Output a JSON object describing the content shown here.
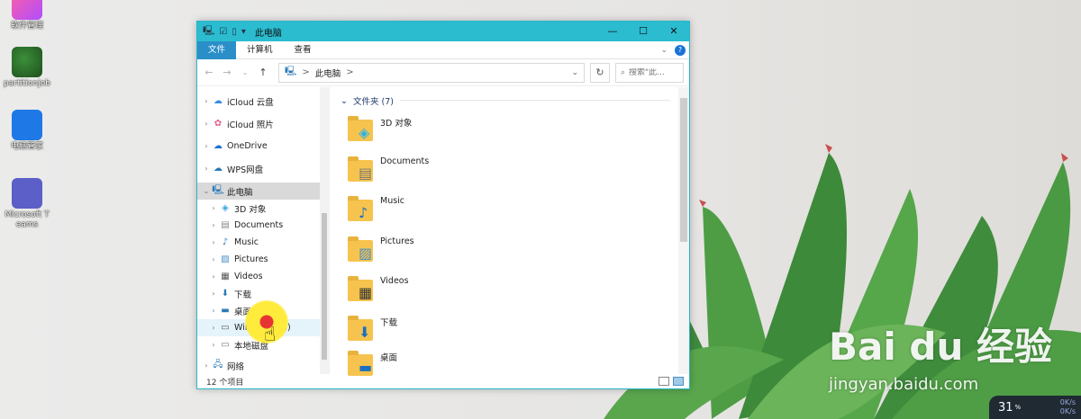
{
  "desktop": {
    "icons": [
      {
        "label": "软件管理",
        "icon": "software-manager-icon"
      },
      {
        "label": "partitionjob",
        "icon": "partition-icon"
      },
      {
        "label": "电脑管家",
        "icon": "pc-manager-icon"
      },
      {
        "label": "Microsoft Teams",
        "icon": "teams-icon"
      }
    ]
  },
  "window": {
    "title": "此电脑",
    "ribbon_tabs": [
      "文件",
      "计算机",
      "查看"
    ],
    "address": {
      "crumb": "此电脑",
      "separator": ">"
    },
    "search_placeholder": "搜索\"此...",
    "nav_tree": [
      {
        "label": "iCloud 云盘",
        "icon": "icloud-icon"
      },
      {
        "label": "iCloud 照片",
        "icon": "photos-icon"
      },
      {
        "label": "OneDrive",
        "icon": "onedrive-icon"
      },
      {
        "label": "WPS网盘",
        "icon": "cloud-icon"
      },
      {
        "label": "此电脑",
        "icon": "computer-icon"
      },
      {
        "label": "3D 对象",
        "icon": "3d-objects-icon"
      },
      {
        "label": "Documents",
        "icon": "documents-icon"
      },
      {
        "label": "Music",
        "icon": "music-icon"
      },
      {
        "label": "Pictures",
        "icon": "pictures-icon"
      },
      {
        "label": "Videos",
        "icon": "videos-icon"
      },
      {
        "label": "下载",
        "icon": "download-icon"
      },
      {
        "label": "桌面",
        "icon": "desktop-icon"
      },
      {
        "label": "Windows (C:)",
        "icon": "drive-icon"
      },
      {
        "label": "本地磁盘",
        "icon": "disk-icon"
      },
      {
        "label": "网络",
        "icon": "network-icon"
      }
    ],
    "group_header": "文件夹 (7)",
    "folders": [
      {
        "name": "3D 对象",
        "icon": "3d-objects-icon"
      },
      {
        "name": "Documents",
        "icon": "documents-icon"
      },
      {
        "name": "Music",
        "icon": "music-icon"
      },
      {
        "name": "Pictures",
        "icon": "pictures-icon"
      },
      {
        "name": "Videos",
        "icon": "videos-icon"
      },
      {
        "name": "下载",
        "icon": "download-icon"
      },
      {
        "name": "桌面",
        "icon": "desktop-icon"
      }
    ],
    "status_text": "12 个项目"
  },
  "watermark": {
    "logo": "Bai du 经验",
    "url": "jingyan.baidu.com"
  },
  "perf_widget": {
    "percent": "31",
    "unit": "%",
    "speed_up": "0K/s",
    "speed_down": "0K/s"
  },
  "colors": {
    "titlebar": "#2bbcd0",
    "ribbon_active": "#2a8fc8",
    "folder": "#f6c44e"
  }
}
